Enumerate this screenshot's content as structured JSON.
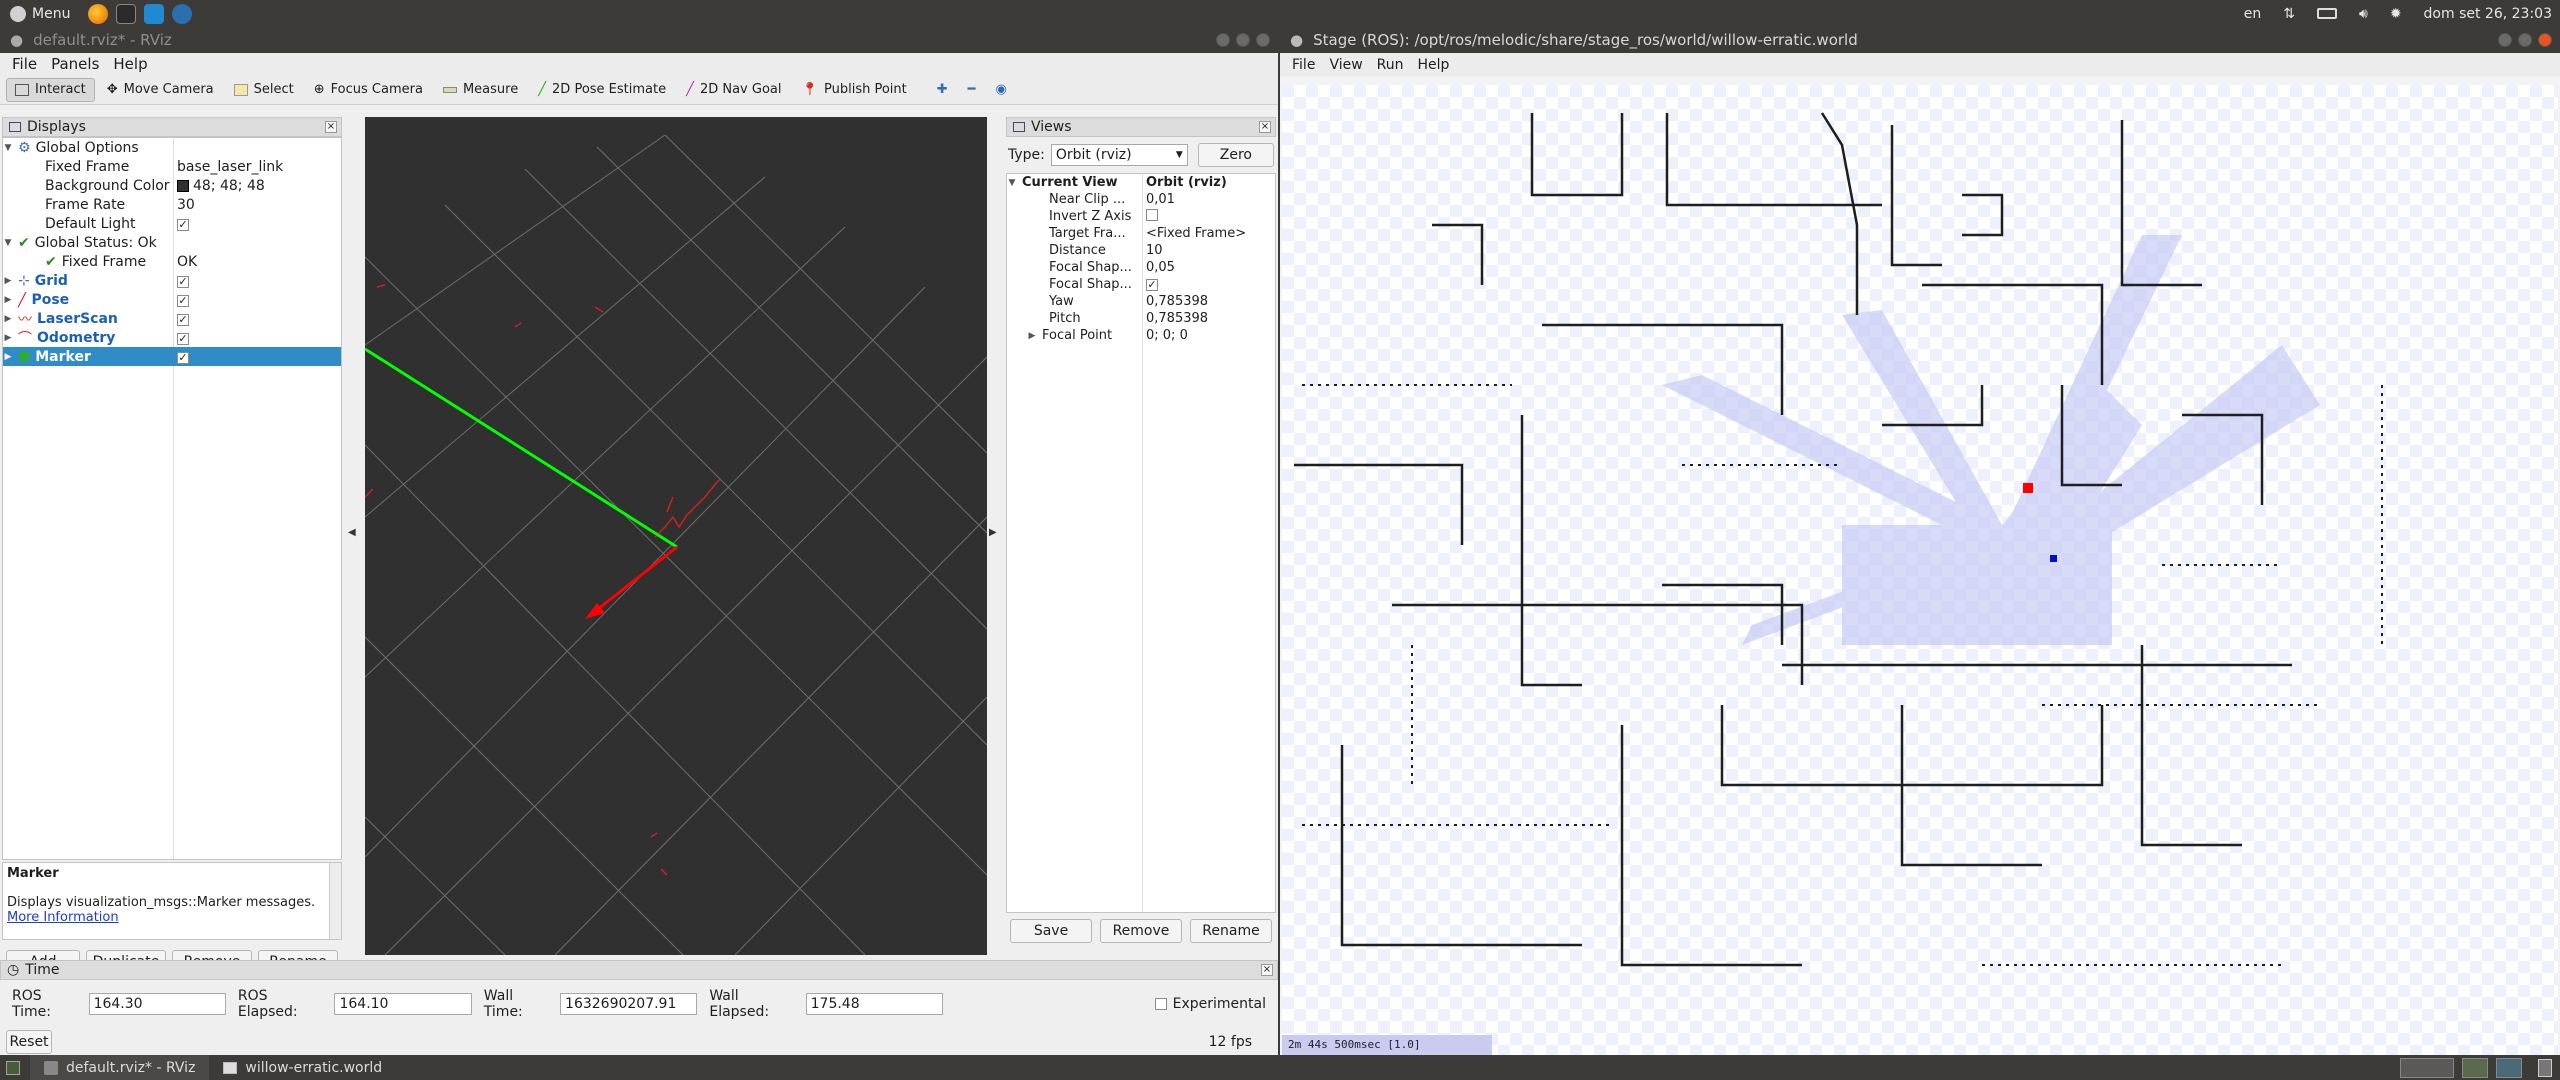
{
  "topbar": {
    "menu_label": "Menu",
    "lang": "en",
    "clock": "dom set 26, 23:03"
  },
  "rviz": {
    "title": "default.rviz* - RViz",
    "menu": [
      "File",
      "Panels",
      "Help"
    ],
    "tools": [
      "Interact",
      "Move Camera",
      "Select",
      "Focus Camera",
      "Measure",
      "2D Pose Estimate",
      "2D Nav Goal",
      "Publish Point"
    ],
    "displays": {
      "header": "Displays",
      "rows": [
        {
          "label": "Global Options",
          "value": ""
        },
        {
          "label": "Fixed Frame",
          "value": "base_laser_link"
        },
        {
          "label": "Background Color",
          "value": "48; 48; 48"
        },
        {
          "label": "Frame Rate",
          "value": "30"
        },
        {
          "label": "Default Light",
          "value": "✓"
        },
        {
          "label": "Global Status: Ok",
          "value": ""
        },
        {
          "label": "Fixed Frame",
          "value": "OK"
        },
        {
          "label": "Grid",
          "value": "✓"
        },
        {
          "label": "Pose",
          "value": "✓"
        },
        {
          "label": "LaserScan",
          "value": "✓"
        },
        {
          "label": "Odometry",
          "value": "✓"
        },
        {
          "label": "Marker",
          "value": "✓"
        }
      ],
      "desc_title": "Marker",
      "desc_text": "Displays visualization_msgs::Marker messages.",
      "desc_link": "More Information",
      "buttons": [
        "Add",
        "Duplicate",
        "Remove",
        "Rename"
      ]
    },
    "views": {
      "header": "Views",
      "type_label": "Type:",
      "type_value": "Orbit (rviz)",
      "zero": "Zero",
      "rows": [
        {
          "label": "Current View",
          "value": "Orbit (rviz)"
        },
        {
          "label": "Near Clip ...",
          "value": "0,01"
        },
        {
          "label": "Invert Z Axis",
          "value": ""
        },
        {
          "label": "Target Fra...",
          "value": "<Fixed Frame>"
        },
        {
          "label": "Distance",
          "value": "10"
        },
        {
          "label": "Focal Shap...",
          "value": "0,05"
        },
        {
          "label": "Focal Shap...",
          "value": "✓"
        },
        {
          "label": "Yaw",
          "value": "0,785398"
        },
        {
          "label": "Pitch",
          "value": "0,785398"
        },
        {
          "label": "Focal Point",
          "value": "0; 0; 0"
        }
      ],
      "buttons": [
        "Save",
        "Remove",
        "Rename"
      ]
    },
    "time": {
      "header": "Time",
      "ros_time_label": "ROS Time:",
      "ros_time": "164.30",
      "ros_elapsed_label": "ROS Elapsed:",
      "ros_elapsed": "164.10",
      "wall_time_label": "Wall Time:",
      "wall_time": "1632690207.91",
      "wall_elapsed_label": "Wall Elapsed:",
      "wall_elapsed": "175.48",
      "experimental": "Experimental",
      "reset": "Reset",
      "fps": "12 fps"
    }
  },
  "stage": {
    "title": "Stage (ROS): /opt/ros/melodic/share/stage_ros/world/willow-erratic.world",
    "menu": [
      "File",
      "View",
      "Run",
      "Help"
    ],
    "status": "2m 44s 500msec [1.0]"
  },
  "taskbar": {
    "items": [
      "default.rviz* - RViz",
      "willow-erratic.world"
    ]
  },
  "colors": {
    "bg": "#303030",
    "grid": "#a0a0a0",
    "axis_x": "#ff0000",
    "axis_y": "#00ff00",
    "selection": "#308cc6"
  }
}
